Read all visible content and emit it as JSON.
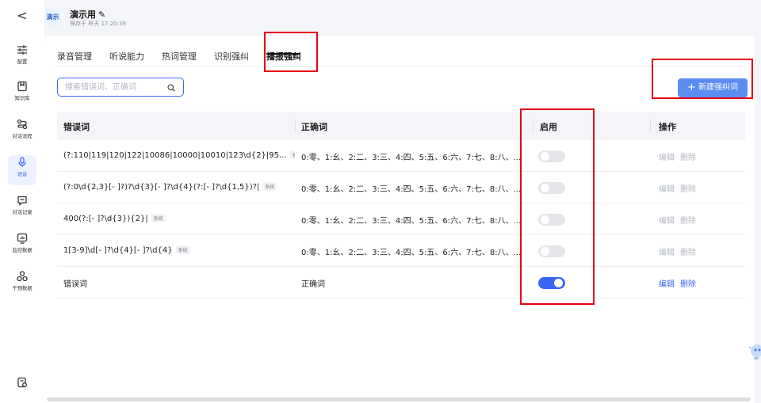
{
  "sidebar": {
    "back_label": "<",
    "items": [
      {
        "label": "配置",
        "icon": "sliders-icon"
      },
      {
        "label": "知识库",
        "icon": "book-icon"
      },
      {
        "label": "对话流程",
        "icon": "flow-icon"
      },
      {
        "label": "语音",
        "icon": "microphone-icon",
        "active": true
      },
      {
        "label": "对话记录",
        "icon": "chat-record-icon"
      },
      {
        "label": "监控数据",
        "icon": "monitor-chart-icon"
      },
      {
        "label": "干预数据",
        "icon": "intervene-icon"
      }
    ],
    "bottom_icon": "document-icon"
  },
  "header": {
    "badge": "演示",
    "title": "演示用",
    "saved_text": "保存于 昨天 17:20:39"
  },
  "tabs": [
    {
      "label": "录音管理"
    },
    {
      "label": "听说能力"
    },
    {
      "label": "热词管理"
    },
    {
      "label": "识别强纠"
    },
    {
      "label": "播报强纠",
      "active": true
    }
  ],
  "search": {
    "placeholder": "搜索错误词、正确词",
    "value": ""
  },
  "new_button": {
    "label": "新建强纠词"
  },
  "table": {
    "columns": [
      "错误词",
      "正确词",
      "启用",
      "操作"
    ],
    "rows": [
      {
        "wrong": "(?:110|119|120|122|10086|10000|10010|123\\d{2}|95...",
        "tag": "系统",
        "right": "0:零、1:幺、2:二、3:三、4:四、5:五、6:六、7:七、8:八、...",
        "enabled": false,
        "edit": "编辑",
        "delete": "删除",
        "ops_enabled": false
      },
      {
        "wrong": "(?:0\\d{2,3}[- ]?)?\\d{3}[- ]?\\d{4}(?:[- ]?\\d{1,5})?|",
        "tag": "系统",
        "right": "0:零、1:幺、2:二、3:三、4:四、5:五、6:六、7:七、8:八、...",
        "enabled": false,
        "edit": "编辑",
        "delete": "删除",
        "ops_enabled": false
      },
      {
        "wrong": "400(?:[- ]?\\d{3}){2}|",
        "tag": "系统",
        "right": "0:零、1:幺、2:二、3:三、4:四、5:五、6:六、7:七、8:八、...",
        "enabled": false,
        "edit": "编辑",
        "delete": "删除",
        "ops_enabled": false
      },
      {
        "wrong": "1[3-9]\\d[- ]?\\d{4}[- ]?\\d{4}",
        "tag": "系统",
        "right": "0:零、1:幺、2:二、3:三、4:四、5:五、6:六、7:七、8:八、...",
        "enabled": false,
        "edit": "编辑",
        "delete": "删除",
        "ops_enabled": false
      },
      {
        "wrong": "错误词",
        "tag": "",
        "right": "正确词",
        "enabled": true,
        "edit": "编辑",
        "delete": "删除",
        "ops_enabled": true
      }
    ]
  },
  "colors": {
    "accent": "#3a66f5",
    "highlight": "#e60012",
    "button": "#5b8cf2"
  }
}
